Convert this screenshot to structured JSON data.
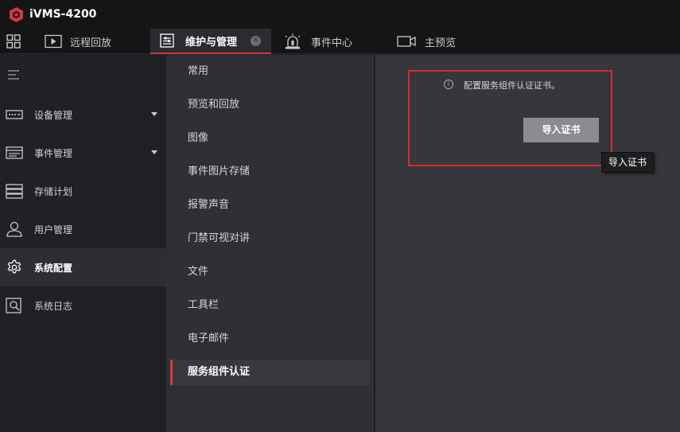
{
  "app": {
    "title": "iVMS-4200"
  },
  "tabs": [
    {
      "label": "远程回放",
      "icon": "play-icon"
    },
    {
      "label": "维护与管理",
      "icon": "maintenance-icon",
      "active": true
    },
    {
      "label": "事件中心",
      "icon": "alarm-icon"
    },
    {
      "label": "主预览",
      "icon": "camera-icon"
    }
  ],
  "sidebar": {
    "items": [
      {
        "label": "设备管理",
        "icon": "device-icon",
        "expandable": true
      },
      {
        "label": "事件管理",
        "icon": "event-icon",
        "expandable": true
      },
      {
        "label": "存储计划",
        "icon": "storage-icon"
      },
      {
        "label": "用户管理",
        "icon": "user-icon"
      },
      {
        "label": "系统配置",
        "icon": "gear-icon",
        "active": true
      },
      {
        "label": "系统日志",
        "icon": "log-icon"
      }
    ]
  },
  "submenu": {
    "items": [
      {
        "label": "常用"
      },
      {
        "label": "预览和回放"
      },
      {
        "label": "图像"
      },
      {
        "label": "事件图片存储"
      },
      {
        "label": "报警声音"
      },
      {
        "label": "门禁可视对讲"
      },
      {
        "label": "文件"
      },
      {
        "label": "工具栏"
      },
      {
        "label": "电子邮件"
      },
      {
        "label": "服务组件认证",
        "active": true
      }
    ]
  },
  "content": {
    "info_text": "配置服务组件认证证书。",
    "import_button": "导入证书",
    "tooltip": "导入证书"
  },
  "colors": {
    "accent": "#d8373d",
    "highlight_box": "#e0262d",
    "button": "#8b8c8f"
  }
}
